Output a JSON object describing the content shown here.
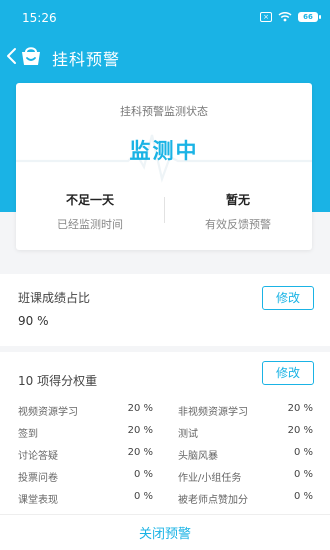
{
  "status_bar": {
    "time": "15:26",
    "battery": "66"
  },
  "header": {
    "title": "挂科预警"
  },
  "monitor_card": {
    "subtitle": "挂科预警监测状态",
    "status": "监测中",
    "stats": [
      {
        "value": "不足一天",
        "label": "已经监测时间"
      },
      {
        "value": "暂无",
        "label": "有效反馈预警"
      }
    ]
  },
  "grade_ratio": {
    "title": "班课成绩占比",
    "value": "90 %",
    "edit_label": "修改"
  },
  "weights": {
    "title": "10 项得分权重",
    "edit_label": "修改",
    "left": [
      {
        "label": "视频资源学习",
        "value": "20 %"
      },
      {
        "label": "签到",
        "value": "20 %"
      },
      {
        "label": "讨论答疑",
        "value": "20 %"
      },
      {
        "label": "投票问卷",
        "value": "0 %"
      },
      {
        "label": "课堂表现",
        "value": "0 %"
      }
    ],
    "right": [
      {
        "label": "非视频资源学习",
        "value": "20 %"
      },
      {
        "label": "测试",
        "value": "20 %"
      },
      {
        "label": "头脑风暴",
        "value": "0 %"
      },
      {
        "label": "作业/小组任务",
        "value": "0 %"
      },
      {
        "label": "被老师点赞加分",
        "value": "0 %"
      }
    ]
  },
  "footer": {
    "close_label": "关闭预警"
  },
  "colors": {
    "accent": "#1ab3e5",
    "background": "#f4f5f7"
  },
  "icons": [
    "back-arrow-icon",
    "app-logo-icon",
    "wifi-icon",
    "battery-icon",
    "sim-icon"
  ]
}
